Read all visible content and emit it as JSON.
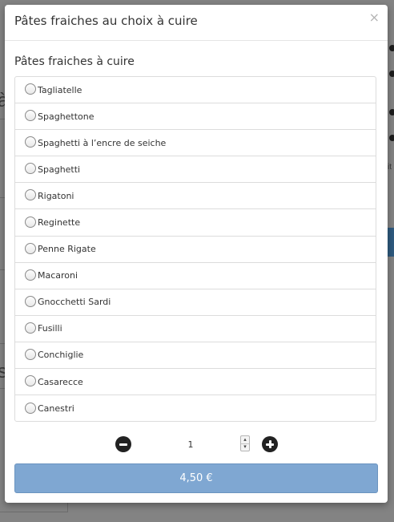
{
  "background": {
    "fragments": [
      "à",
      "s",
      "it"
    ]
  },
  "modal": {
    "title": "Pâtes fraiches au choix à cuire",
    "close_label": "×",
    "group_title": "Pâtes fraiches à cuire",
    "options": [
      {
        "label": "Tagliatelle"
      },
      {
        "label": "Spaghettone"
      },
      {
        "label": "Spaghetti à l’encre de seiche"
      },
      {
        "label": "Spaghetti"
      },
      {
        "label": "Rigatoni"
      },
      {
        "label": "Reginette"
      },
      {
        "label": "Penne Rigate"
      },
      {
        "label": "Macaroni"
      },
      {
        "label": "Gnocchetti Sardi"
      },
      {
        "label": "Fusilli"
      },
      {
        "label": "Conchiglie"
      },
      {
        "label": "Casarecce"
      },
      {
        "label": "Canestri"
      }
    ],
    "quantity": {
      "value": "1",
      "spin_up": "▴",
      "spin_down": "▾",
      "minus_icon": "minus-circle-icon",
      "plus_icon": "plus-circle-icon"
    },
    "price_label": "4,50 €"
  },
  "colors": {
    "overlay": "#838383",
    "price_button": "#7fa7d2",
    "icon_dark": "#222222"
  }
}
